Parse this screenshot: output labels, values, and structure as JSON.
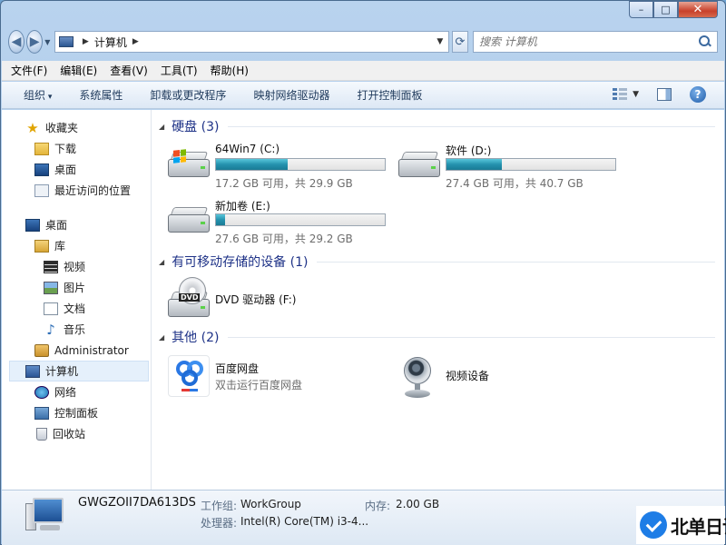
{
  "window": {
    "caption": {
      "minimize": "–",
      "maximize": "□",
      "close": "✕"
    }
  },
  "address": {
    "crumbs": [
      "计算机"
    ],
    "search_placeholder": "搜索 计算机"
  },
  "menu": [
    "文件(F)",
    "编辑(E)",
    "查看(V)",
    "工具(T)",
    "帮助(H)"
  ],
  "commands": [
    "组织",
    "系统属性",
    "卸载或更改程序",
    "映射网络驱动器",
    "打开控制面板"
  ],
  "nav": {
    "favorites": [
      "收藏夹",
      "下载",
      "桌面",
      "最近访问的位置"
    ],
    "desktop": "桌面",
    "library": "库",
    "library_items": [
      "视频",
      "图片",
      "文档",
      "音乐"
    ],
    "administrator": "Administrator",
    "computer": "计算机",
    "network": "网络",
    "control_panel": "控制面板",
    "recycle_bin": "回收站"
  },
  "groups": {
    "hdd": "硬盘 (3)",
    "removable": "有可移动存储的设备 (1)",
    "other": "其他 (2)"
  },
  "drives": [
    {
      "name": "64Win7  (C:)",
      "info": "17.2 GB 可用，共 29.9 GB",
      "used_fraction": 0.425,
      "system": true
    },
    {
      "name": "软件 (D:)",
      "info": "27.4 GB 可用，共 40.7 GB",
      "used_fraction": 0.327,
      "system": false
    },
    {
      "name": "新加卷 (E:)",
      "info": "27.6 GB 可用，共 29.2 GB",
      "used_fraction": 0.055,
      "system": false
    }
  ],
  "dvd": {
    "label": "DVD",
    "name": "DVD 驱动器 (F:)"
  },
  "other_items": [
    {
      "name": "百度网盘",
      "sub": "双击运行百度网盘"
    },
    {
      "name": "视频设备",
      "sub": ""
    }
  ],
  "details": {
    "computer_name": "GWGZOII7DA613DS",
    "workgroup_label": "工作组:",
    "workgroup_value": "WorkGroup",
    "memory_label": "内存:",
    "memory_value": "2.00 GB",
    "cpu_label": "处理器:",
    "cpu_value": "Intel(R) Core(TM) i3-4..."
  },
  "watermark": "北单日记"
}
